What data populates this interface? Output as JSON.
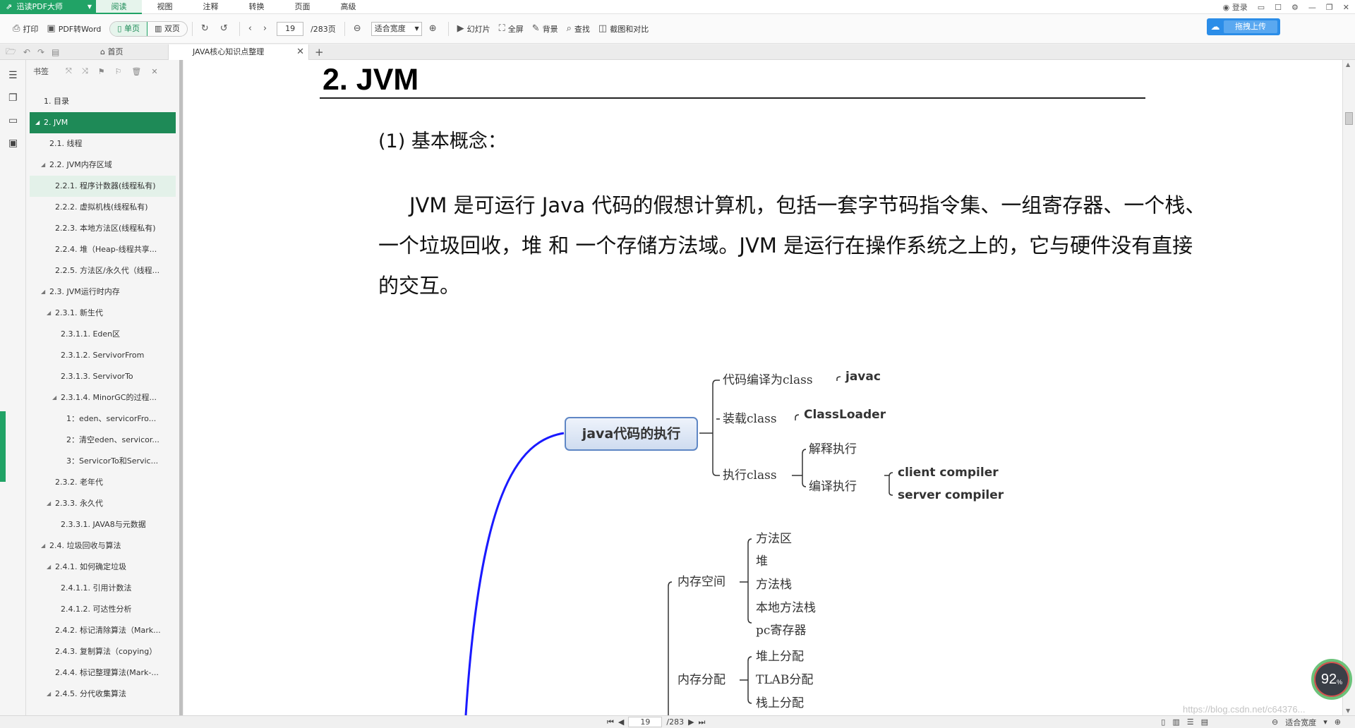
{
  "app": {
    "brand": "迅读PDF大师",
    "menu": [
      "阅读",
      "视图",
      "注释",
      "转换",
      "页面",
      "高级"
    ],
    "active_menu": "阅读",
    "login": "登录"
  },
  "toolbar": {
    "print": "打印",
    "pdf_to_word": "PDF转Word",
    "single_page": "单页",
    "double_page": "双页",
    "current_page": "19",
    "total_pages": "/283页",
    "zoom": "适合宽度",
    "slideshow": "幻灯片",
    "fullscreen": "全屏",
    "background": "背景",
    "find": "查找",
    "screenshot_compare": "截图和对比",
    "upload": "拖拽上传"
  },
  "tabs": {
    "home": "首页",
    "document": "JAVA核心知识点整理"
  },
  "bookmarks": {
    "title": "书签",
    "items": [
      {
        "label": "1. 目录",
        "indent": 1,
        "tri": false
      },
      {
        "label": "2. JVM",
        "indent": 1,
        "tri": true
      },
      {
        "label": "2.1. 线程",
        "indent": 2,
        "tri": false
      },
      {
        "label": "2.2. JVM内存区域",
        "indent": 2,
        "tri": true
      },
      {
        "label": "2.2.1. 程序计数器(线程私有)",
        "indent": 3,
        "tri": false
      },
      {
        "label": "2.2.2. 虚拟机栈(线程私有)",
        "indent": 3,
        "tri": false
      },
      {
        "label": "2.2.3. 本地方法区(线程私有)",
        "indent": 3,
        "tri": false
      },
      {
        "label": "2.2.4. 堆（Heap-线程共享...",
        "indent": 3,
        "tri": false
      },
      {
        "label": "2.2.5. 方法区/永久代（线程...",
        "indent": 3,
        "tri": false
      },
      {
        "label": "2.3. JVM运行时内存",
        "indent": 2,
        "tri": true
      },
      {
        "label": "2.3.1. 新生代",
        "indent": 3,
        "tri": true
      },
      {
        "label": "2.3.1.1. Eden区",
        "indent": 4,
        "tri": false
      },
      {
        "label": "2.3.1.2. ServivorFrom",
        "indent": 4,
        "tri": false
      },
      {
        "label": "2.3.1.3. ServivorTo",
        "indent": 4,
        "tri": false
      },
      {
        "label": "2.3.1.4.  MinorGC的过程...",
        "indent": 4,
        "tri": true
      },
      {
        "label": "1：eden、servicorFro...",
        "indent": 5,
        "tri": false
      },
      {
        "label": "2：清空eden、servicor...",
        "indent": 5,
        "tri": false
      },
      {
        "label": "3：ServicorTo和Servic...",
        "indent": 5,
        "tri": false
      },
      {
        "label": "2.3.2. 老年代",
        "indent": 3,
        "tri": false
      },
      {
        "label": "2.3.3. 永久代",
        "indent": 3,
        "tri": true
      },
      {
        "label": "2.3.3.1. JAVA8与元数据",
        "indent": 4,
        "tri": false
      },
      {
        "label": "2.4. 垃圾回收与算法",
        "indent": 2,
        "tri": true
      },
      {
        "label": "2.4.1. 如何确定垃圾",
        "indent": 3,
        "tri": true
      },
      {
        "label": "2.4.1.1. 引用计数法",
        "indent": 4,
        "tri": false
      },
      {
        "label": "2.4.1.2. 可达性分析",
        "indent": 4,
        "tri": false
      },
      {
        "label": "2.4.2. 标记清除算法（Mark...",
        "indent": 3,
        "tri": false
      },
      {
        "label": "2.4.3. 复制算法（copying）",
        "indent": 3,
        "tri": false
      },
      {
        "label": "2.4.4. 标记整理算法(Mark-...",
        "indent": 3,
        "tri": false
      },
      {
        "label": "2.4.5. 分代收集算法",
        "indent": 3,
        "tri": true
      }
    ]
  },
  "document": {
    "title": "2. JVM",
    "subheading": "(1) 基本概念：",
    "paragraph": "JVM 是可运行 Java 代码的假想计算机，包括一套字节码指令集、一组寄存器、一个栈、一个垃圾回收，堆 和 一个存储方法域。JVM 是运行在操作系统之上的，它与硬件没有直接的交互。",
    "mindmap": {
      "root": "java代码的执行",
      "compile_to_class": "代码编译为class",
      "javac": "javac",
      "load_class": "装载class",
      "classloader": "ClassLoader",
      "exec_class": "执行class",
      "interpret": "解释执行",
      "compile_exec": "编译执行",
      "client_compiler": "client compiler",
      "server_compiler": "server compiler",
      "memory_space": "内存空间",
      "method_area": "方法区",
      "heap": "堆",
      "method_stack": "方法栈",
      "native_method_stack": "本地方法栈",
      "pc_register": "pc寄存器",
      "memory_alloc": "内存分配",
      "heap_alloc": "堆上分配",
      "tlab_alloc": "TLAB分配",
      "stack_alloc": "栈上分配"
    }
  },
  "status": {
    "page": "19",
    "total": "/283",
    "zoom": "适合宽度",
    "watermark": "https://blog.csdn.net/c64376..."
  },
  "gauge": {
    "value": "92",
    "unit": "%"
  },
  "colors": {
    "accent": "#21a366",
    "active_bookmark": "#1e8a57",
    "upload": "#2b8de8",
    "mindmap_line": "#1a1aff"
  }
}
